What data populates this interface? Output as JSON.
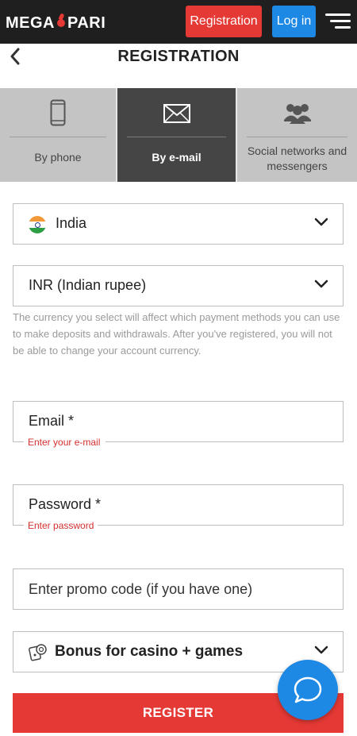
{
  "topbar": {
    "logo_left": "MEGA",
    "logo_right": "PARI",
    "registration_label": "Registration",
    "login_label": "Log in",
    "menu_icon": "hamburger-menu-icon"
  },
  "header": {
    "back_icon": "chevron-left-icon",
    "title": "REGISTRATION"
  },
  "tabs": [
    {
      "label": "By phone",
      "icon": "smartphone-icon",
      "active": false
    },
    {
      "label": "By e-mail",
      "icon": "envelope-icon",
      "active": true
    },
    {
      "label": "Social networks and messengers",
      "icon": "people-group-icon",
      "active": false
    }
  ],
  "form": {
    "country": {
      "value": "India",
      "flag": "india-flag-icon"
    },
    "currency": {
      "value": "INR (Indian rupee)"
    },
    "currency_hint": "The currency you select will affect which payment methods you can use to make deposits and withdrawals. After you've registered, you will not be able to change your account currency.",
    "email": {
      "placeholder": "Email  *",
      "error": "Enter your e-mail"
    },
    "password": {
      "placeholder": "Password  *",
      "error": "Enter password"
    },
    "promo": {
      "placeholder": "Enter promo code (if you have one)"
    },
    "bonus": {
      "value": "Bonus for casino + games",
      "icon": "casino-chip-icon"
    },
    "register_label": "REGISTER"
  },
  "chat": {
    "icon": "chat-bubble-icon"
  },
  "colors": {
    "topbar": "#1f1f1f",
    "accent_red": "#e53935",
    "accent_blue": "#1e88e5",
    "tab_inactive": "#c4c4c4",
    "tab_active": "#454545",
    "error": "#d32f2f"
  }
}
